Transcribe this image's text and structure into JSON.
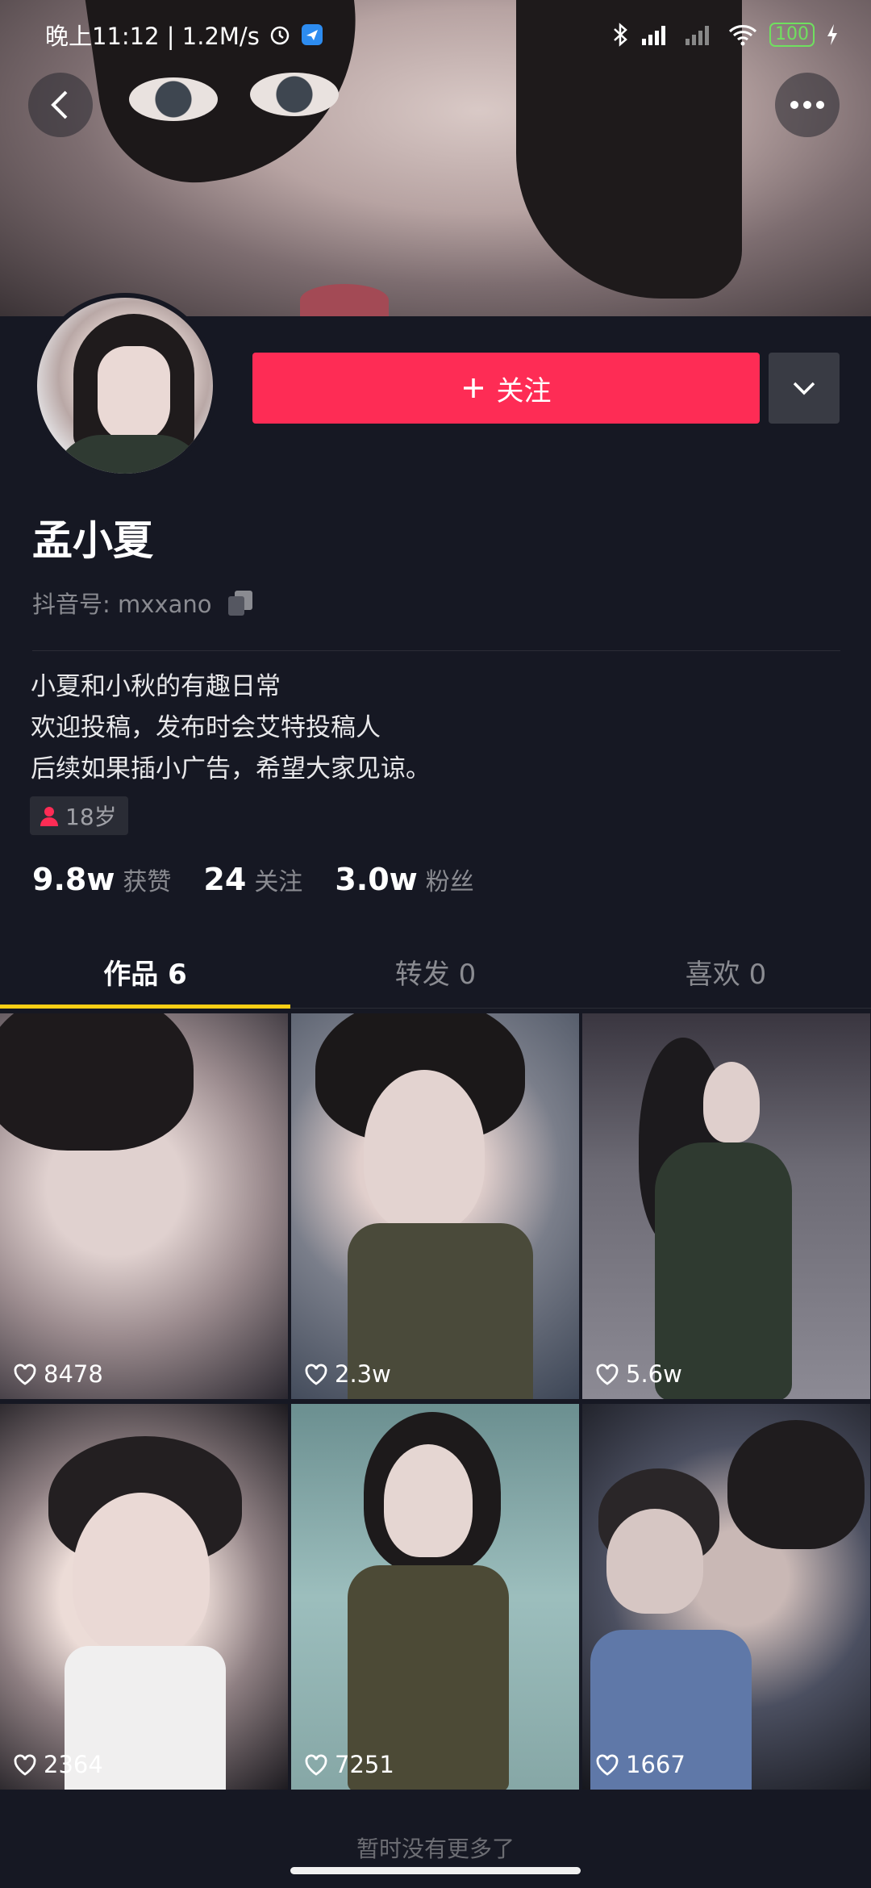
{
  "status_bar": {
    "time_speed": "晚上11:12 | 1.2M/s",
    "battery": "100"
  },
  "profile": {
    "follow_label": "关注",
    "name": "孟小夏",
    "douyin_id": "抖音号: mxxano",
    "bio": [
      "小夏和小秋的有趣日常",
      "欢迎投稿，发布时会艾特投稿人",
      "后续如果插小广告，希望大家见谅。"
    ],
    "age_tag": "18岁"
  },
  "stats": [
    {
      "value": "9.8w",
      "label": "获赞"
    },
    {
      "value": "24",
      "label": "关注"
    },
    {
      "value": "3.0w",
      "label": "粉丝"
    }
  ],
  "tabs": [
    {
      "label": "作品 6",
      "active": true
    },
    {
      "label": "转发 0",
      "active": false
    },
    {
      "label": "喜欢 0",
      "active": false
    }
  ],
  "videos": [
    {
      "likes": "8478"
    },
    {
      "likes": "2.3w"
    },
    {
      "likes": "5.6w"
    },
    {
      "likes": "2364"
    },
    {
      "likes": "7251"
    },
    {
      "likes": "1667"
    }
  ],
  "footer": {
    "end_text": "暂时没有更多了"
  },
  "colors": {
    "accent": "#fe2c55",
    "tab_indicator": "#face15",
    "background": "#161823"
  }
}
